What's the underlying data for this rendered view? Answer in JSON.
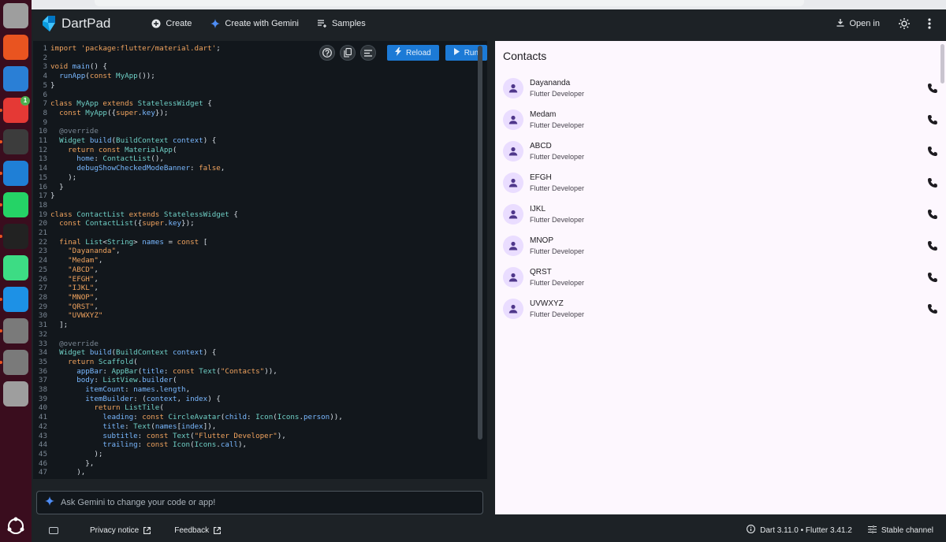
{
  "dock": {
    "items": [
      {
        "name": "files-icon",
        "color": "#9e9e9e"
      },
      {
        "name": "app-center-icon",
        "color": "#e95420"
      },
      {
        "name": "help-icon",
        "color": "#2a7fd6"
      },
      {
        "name": "chrome-icon",
        "color": "#e53935",
        "badge": "1"
      },
      {
        "name": "terminal-icon",
        "color": "#3c3c3c"
      },
      {
        "name": "vscode-icon",
        "color": "#1f7fd6"
      },
      {
        "name": "whatsapp-icon",
        "color": "#25d366"
      },
      {
        "name": "intellij-icon",
        "color": "#222222"
      },
      {
        "name": "android-studio-icon",
        "color": "#3ddc84"
      },
      {
        "name": "docker-icon",
        "color": "#1d91e6"
      },
      {
        "name": "settings-icon",
        "color": "#7a7a7a"
      },
      {
        "name": "settings-2-icon",
        "color": "#7a7a7a"
      },
      {
        "name": "trash-icon",
        "color": "#9e9e9e"
      }
    ]
  },
  "topbar": {
    "app_title": "DartPad",
    "create_label": "Create",
    "create_gemini_label": "Create with Gemini",
    "samples_label": "Samples",
    "open_in_label": "Open in"
  },
  "editor": {
    "reload_label": "Reload",
    "run_label": "Run",
    "lines": [
      [
        [
          "kw",
          "import "
        ],
        [
          "str",
          "'package:flutter/material.dart'"
        ],
        [
          "cl",
          ";"
        ]
      ],
      [],
      [
        [
          "kw",
          "void "
        ],
        [
          "fn",
          "main"
        ],
        [
          "cl",
          "() {"
        ]
      ],
      [
        [
          "cl",
          "  "
        ],
        [
          "fn",
          "runApp"
        ],
        [
          "cl",
          "("
        ],
        [
          "kw",
          "const "
        ],
        [
          "ty",
          "MyApp"
        ],
        [
          "cl",
          "());"
        ]
      ],
      [
        [
          "cl",
          "}"
        ]
      ],
      [],
      [
        [
          "kw",
          "class "
        ],
        [
          "ty",
          "MyApp "
        ],
        [
          "kw",
          "extends "
        ],
        [
          "ty",
          "StatelessWidget "
        ],
        [
          "cl",
          "{"
        ]
      ],
      [
        [
          "cl",
          "  "
        ],
        [
          "kw",
          "const "
        ],
        [
          "ty",
          "MyApp"
        ],
        [
          "cl",
          "({"
        ],
        [
          "kw",
          "super"
        ],
        [
          "cl",
          "."
        ],
        [
          "prm",
          "key"
        ],
        [
          "cl",
          "});"
        ]
      ],
      [],
      [
        [
          "cm",
          "  @override"
        ]
      ],
      [
        [
          "cl",
          "  "
        ],
        [
          "ty",
          "Widget "
        ],
        [
          "fn",
          "build"
        ],
        [
          "cl",
          "("
        ],
        [
          "ty",
          "BuildContext "
        ],
        [
          "prm",
          "context"
        ],
        [
          "cl",
          ") {"
        ]
      ],
      [
        [
          "cl",
          "    "
        ],
        [
          "kw",
          "return const "
        ],
        [
          "ty",
          "MaterialApp"
        ],
        [
          "cl",
          "("
        ]
      ],
      [
        [
          "cl",
          "      "
        ],
        [
          "prm",
          "home"
        ],
        [
          "cl",
          ": "
        ],
        [
          "ty",
          "ContactList"
        ],
        [
          "cl",
          "(),"
        ]
      ],
      [
        [
          "cl",
          "      "
        ],
        [
          "prm",
          "debugShowCheckedModeBanner"
        ],
        [
          "cl",
          ": "
        ],
        [
          "kw",
          "false"
        ],
        [
          "cl",
          ","
        ]
      ],
      [
        [
          "cl",
          "    );"
        ]
      ],
      [
        [
          "cl",
          "  }"
        ]
      ],
      [
        [
          "cl",
          "}"
        ]
      ],
      [],
      [
        [
          "kw",
          "class "
        ],
        [
          "ty",
          "ContactList "
        ],
        [
          "kw",
          "extends "
        ],
        [
          "ty",
          "StatelessWidget "
        ],
        [
          "cl",
          "{"
        ]
      ],
      [
        [
          "cl",
          "  "
        ],
        [
          "kw",
          "const "
        ],
        [
          "ty",
          "ContactList"
        ],
        [
          "cl",
          "({"
        ],
        [
          "kw",
          "super"
        ],
        [
          "cl",
          "."
        ],
        [
          "prm",
          "key"
        ],
        [
          "cl",
          "});"
        ]
      ],
      [],
      [
        [
          "cl",
          "  "
        ],
        [
          "kw",
          "final "
        ],
        [
          "ty",
          "List"
        ],
        [
          "cl",
          "<"
        ],
        [
          "ty",
          "String"
        ],
        [
          "cl",
          "> "
        ],
        [
          "prm",
          "names"
        ],
        [
          "cl",
          " = "
        ],
        [
          "kw",
          "const "
        ],
        [
          "cl",
          "["
        ]
      ],
      [
        [
          "cl",
          "    "
        ],
        [
          "str",
          "\"Dayananda\""
        ],
        [
          "cl",
          ","
        ]
      ],
      [
        [
          "cl",
          "    "
        ],
        [
          "str",
          "\"Medam\""
        ],
        [
          "cl",
          ","
        ]
      ],
      [
        [
          "cl",
          "    "
        ],
        [
          "str",
          "\"ABCD\""
        ],
        [
          "cl",
          ","
        ]
      ],
      [
        [
          "cl",
          "    "
        ],
        [
          "str",
          "\"EFGH\""
        ],
        [
          "cl",
          ","
        ]
      ],
      [
        [
          "cl",
          "    "
        ],
        [
          "str",
          "\"IJKL\""
        ],
        [
          "cl",
          ","
        ]
      ],
      [
        [
          "cl",
          "    "
        ],
        [
          "str",
          "\"MNOP\""
        ],
        [
          "cl",
          ","
        ]
      ],
      [
        [
          "cl",
          "    "
        ],
        [
          "str",
          "\"QRST\""
        ],
        [
          "cl",
          ","
        ]
      ],
      [
        [
          "cl",
          "    "
        ],
        [
          "str",
          "\"UVWXYZ\""
        ]
      ],
      [
        [
          "cl",
          "  ];"
        ]
      ],
      [],
      [
        [
          "cm",
          "  @override"
        ]
      ],
      [
        [
          "cl",
          "  "
        ],
        [
          "ty",
          "Widget "
        ],
        [
          "fn",
          "build"
        ],
        [
          "cl",
          "("
        ],
        [
          "ty",
          "BuildContext "
        ],
        [
          "prm",
          "context"
        ],
        [
          "cl",
          ") {"
        ]
      ],
      [
        [
          "cl",
          "    "
        ],
        [
          "kw",
          "return "
        ],
        [
          "ty",
          "Scaffold"
        ],
        [
          "cl",
          "("
        ]
      ],
      [
        [
          "cl",
          "      "
        ],
        [
          "prm",
          "appBar"
        ],
        [
          "cl",
          ": "
        ],
        [
          "ty",
          "AppBar"
        ],
        [
          "cl",
          "("
        ],
        [
          "prm",
          "title"
        ],
        [
          "cl",
          ": "
        ],
        [
          "kw",
          "const "
        ],
        [
          "ty",
          "Text"
        ],
        [
          "cl",
          "("
        ],
        [
          "str",
          "\"Contacts\""
        ],
        [
          "cl",
          ")),"
        ]
      ],
      [
        [
          "cl",
          "      "
        ],
        [
          "prm",
          "body"
        ],
        [
          "cl",
          ": "
        ],
        [
          "ty",
          "ListView"
        ],
        [
          "cl",
          "."
        ],
        [
          "fn",
          "builder"
        ],
        [
          "cl",
          "("
        ]
      ],
      [
        [
          "cl",
          "        "
        ],
        [
          "prm",
          "itemCount"
        ],
        [
          "cl",
          ": "
        ],
        [
          "prm",
          "names"
        ],
        [
          "cl",
          "."
        ],
        [
          "prm",
          "length"
        ],
        [
          "cl",
          ","
        ]
      ],
      [
        [
          "cl",
          "        "
        ],
        [
          "prm",
          "itemBuilder"
        ],
        [
          "cl",
          ": ("
        ],
        [
          "prm",
          "context"
        ],
        [
          "cl",
          ", "
        ],
        [
          "prm",
          "index"
        ],
        [
          "cl",
          ") {"
        ]
      ],
      [
        [
          "cl",
          "          "
        ],
        [
          "kw",
          "return "
        ],
        [
          "ty",
          "ListTile"
        ],
        [
          "cl",
          "("
        ]
      ],
      [
        [
          "cl",
          "            "
        ],
        [
          "prm",
          "leading"
        ],
        [
          "cl",
          ": "
        ],
        [
          "kw",
          "const "
        ],
        [
          "ty",
          "CircleAvatar"
        ],
        [
          "cl",
          "("
        ],
        [
          "prm",
          "child"
        ],
        [
          "cl",
          ": "
        ],
        [
          "ty",
          "Icon"
        ],
        [
          "cl",
          "("
        ],
        [
          "ty",
          "Icons"
        ],
        [
          "cl",
          "."
        ],
        [
          "prm",
          "person"
        ],
        [
          "cl",
          ")),"
        ]
      ],
      [
        [
          "cl",
          "            "
        ],
        [
          "prm",
          "title"
        ],
        [
          "cl",
          ": "
        ],
        [
          "ty",
          "Text"
        ],
        [
          "cl",
          "("
        ],
        [
          "prm",
          "names"
        ],
        [
          "cl",
          "["
        ],
        [
          "prm",
          "index"
        ],
        [
          "cl",
          "]),"
        ]
      ],
      [
        [
          "cl",
          "            "
        ],
        [
          "prm",
          "subtitle"
        ],
        [
          "cl",
          ": "
        ],
        [
          "kw",
          "const "
        ],
        [
          "ty",
          "Text"
        ],
        [
          "cl",
          "("
        ],
        [
          "str",
          "\"Flutter Developer\""
        ],
        [
          "cl",
          "),"
        ]
      ],
      [
        [
          "cl",
          "            "
        ],
        [
          "prm",
          "trailing"
        ],
        [
          "cl",
          ": "
        ],
        [
          "kw",
          "const "
        ],
        [
          "ty",
          "Icon"
        ],
        [
          "cl",
          "("
        ],
        [
          "ty",
          "Icons"
        ],
        [
          "cl",
          "."
        ],
        [
          "prm",
          "call"
        ],
        [
          "cl",
          "),"
        ]
      ],
      [
        [
          "cl",
          "          );"
        ]
      ],
      [
        [
          "cl",
          "        },"
        ]
      ],
      [
        [
          "cl",
          "      ),"
        ]
      ]
    ]
  },
  "gemini": {
    "placeholder": "Ask Gemini to change your code or app!"
  },
  "preview": {
    "appbar_title": "Contacts",
    "contacts": [
      {
        "name": "Dayananda",
        "subtitle": "Flutter Developer"
      },
      {
        "name": "Medam",
        "subtitle": "Flutter Developer"
      },
      {
        "name": "ABCD",
        "subtitle": "Flutter Developer"
      },
      {
        "name": "EFGH",
        "subtitle": "Flutter Developer"
      },
      {
        "name": "IJKL",
        "subtitle": "Flutter Developer"
      },
      {
        "name": "MNOP",
        "subtitle": "Flutter Developer"
      },
      {
        "name": "QRST",
        "subtitle": "Flutter Developer"
      },
      {
        "name": "UVWXYZ",
        "subtitle": "Flutter Developer"
      }
    ]
  },
  "footer": {
    "privacy_label": "Privacy notice",
    "feedback_label": "Feedback",
    "version_label": "Dart 3.11.0 • Flutter 3.41.2",
    "channel_label": "Stable channel"
  }
}
